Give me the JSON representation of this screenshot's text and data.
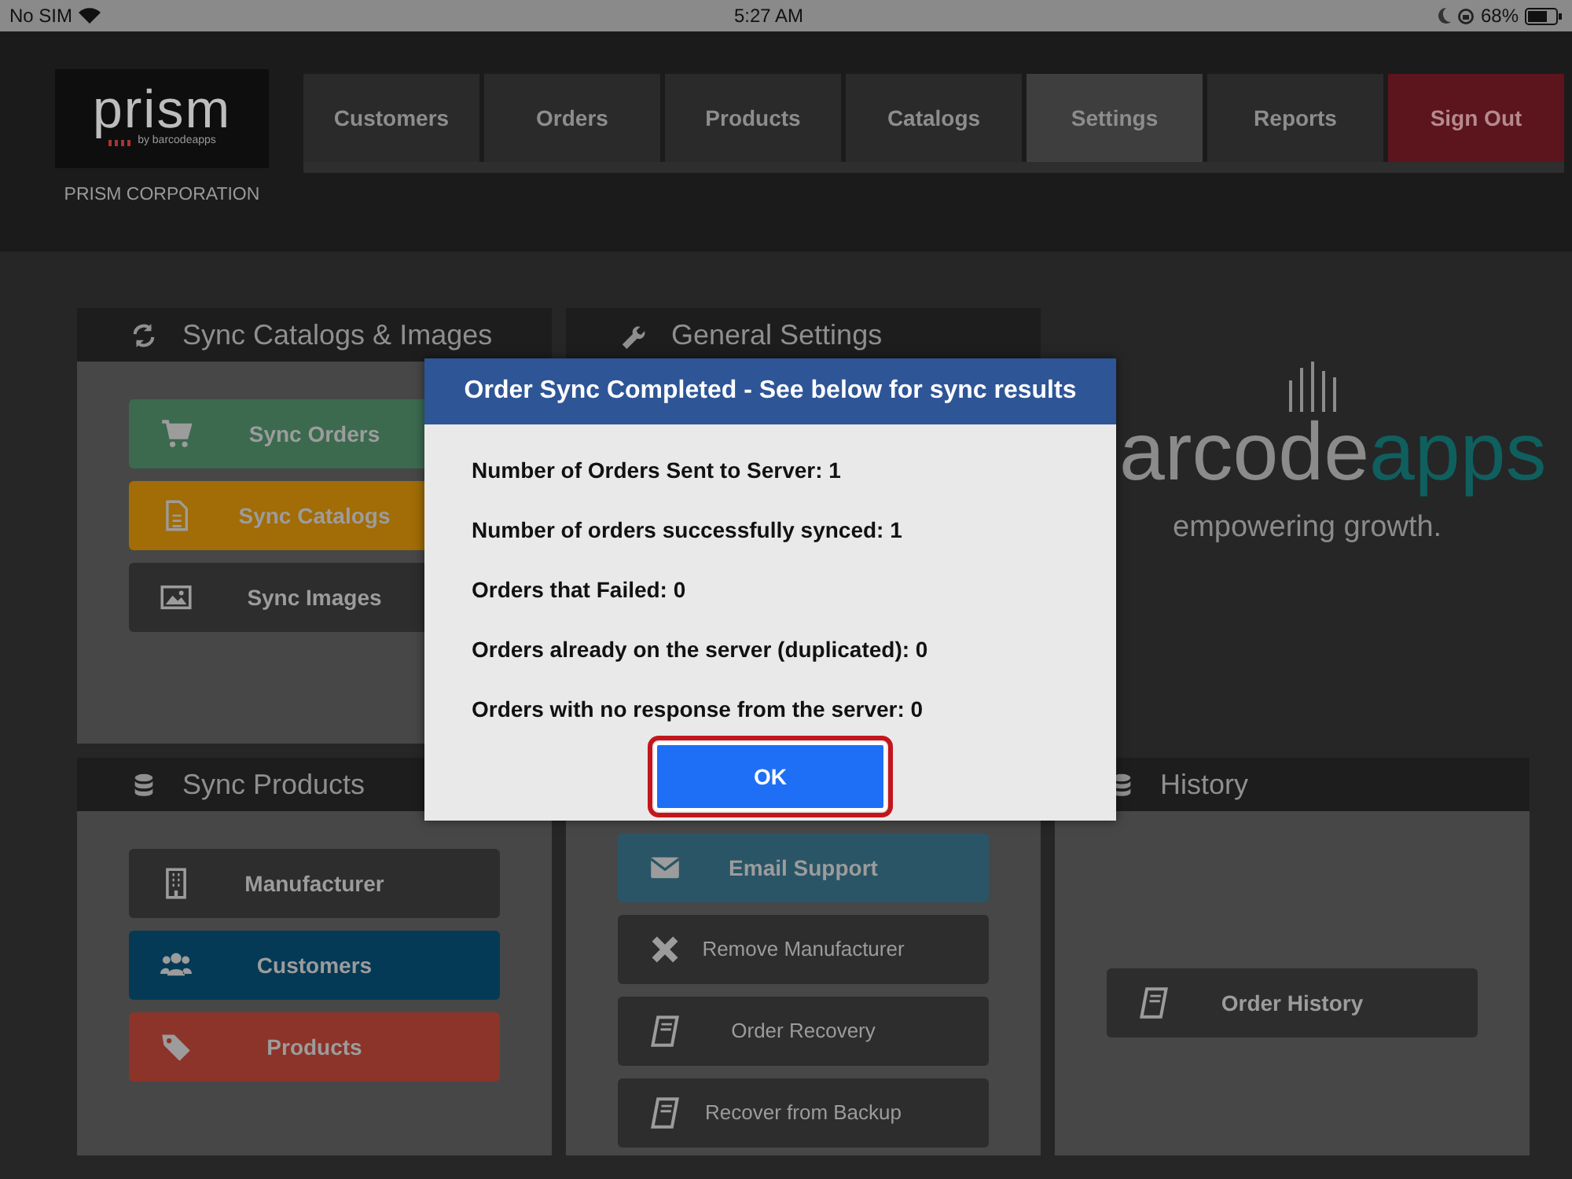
{
  "status_bar": {
    "carrier": "No SIM",
    "time": "5:27 AM",
    "battery": "68%"
  },
  "logo": {
    "name": "prism",
    "byline": "by barcodeapps",
    "company": "PRISM CORPORATION"
  },
  "nav_tabs": [
    {
      "label": "Customers",
      "kind": "tab",
      "selected": false
    },
    {
      "label": "Orders",
      "kind": "tab",
      "selected": false
    },
    {
      "label": "Products",
      "kind": "tab",
      "selected": false
    },
    {
      "label": "Catalogs",
      "kind": "tab",
      "selected": false
    },
    {
      "label": "Settings",
      "kind": "tab",
      "selected": true
    },
    {
      "label": "Reports",
      "kind": "tab",
      "selected": false
    },
    {
      "label": "Sign Out",
      "kind": "danger",
      "selected": false
    }
  ],
  "panels": [
    {
      "title": "Sync Catalogs & Images",
      "buttons": [
        {
          "label": "Sync Orders",
          "color": "#3b6a4f",
          "bold": true
        },
        {
          "label": "Sync Catalogs",
          "color": "#a26c06",
          "bold": true
        },
        {
          "label": "Sync Images",
          "color": "#2d2d2d",
          "bold": true
        }
      ]
    },
    {
      "title": "General Settings"
    },
    {
      "title": "Sync Products",
      "buttons": [
        {
          "label": "Manufacturer",
          "color": "#2d2d2d",
          "bold": true
        },
        {
          "label": "Customers",
          "color": "#053a56",
          "bold": true
        },
        {
          "label": "Products",
          "color": "#8c3429",
          "bold": true
        }
      ]
    },
    {
      "buttons": [
        {
          "label": "Email Support",
          "color": "#2a5566",
          "bold": true
        },
        {
          "label": "Remove Manufacturer",
          "color": "#2d2d2d",
          "bold": false
        },
        {
          "label": "Order Recovery",
          "color": "#2d2d2d",
          "bold": false
        },
        {
          "label": "Recover from Backup",
          "color": "#2d2d2d",
          "bold": false
        }
      ]
    },
    {
      "title": "History",
      "buttons": [
        {
          "label": "Order History",
          "color": "#2d2d2d",
          "bold": true
        }
      ]
    }
  ],
  "brand": {
    "wordmark_main": "arcode",
    "wordmark_accent": "apps",
    "tagline": "empowering growth."
  },
  "dialog": {
    "title": "Order Sync Completed - See below for sync results",
    "lines": [
      "Number of Orders Sent to Server: 1",
      "Number of orders successfully synced: 1",
      "Orders that Failed: 0",
      "Orders already on the server (duplicated): 0",
      "Orders with no response from the server: 0"
    ],
    "ok_button": "OK"
  }
}
